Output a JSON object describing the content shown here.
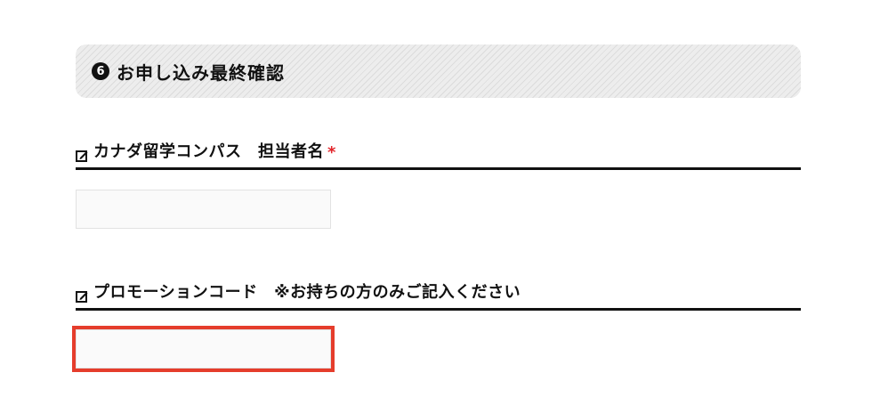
{
  "section": {
    "step_number": "6",
    "title": "お申し込み最終確認"
  },
  "fields": [
    {
      "label": "カナダ留学コンパス　担当者名",
      "required_mark": "*",
      "value": "",
      "placeholder": ""
    },
    {
      "label": "プロモーションコード　※お持ちの方のみご記入ください",
      "value": "",
      "placeholder": ""
    }
  ],
  "icons": {
    "step_badge": "circled-number-icon",
    "field_label_icon": "edit-icon"
  },
  "colors": {
    "required": "#e2252b",
    "highlight": "#e53d2c",
    "input_background": "#fafafa",
    "header_background": "#ededed"
  }
}
